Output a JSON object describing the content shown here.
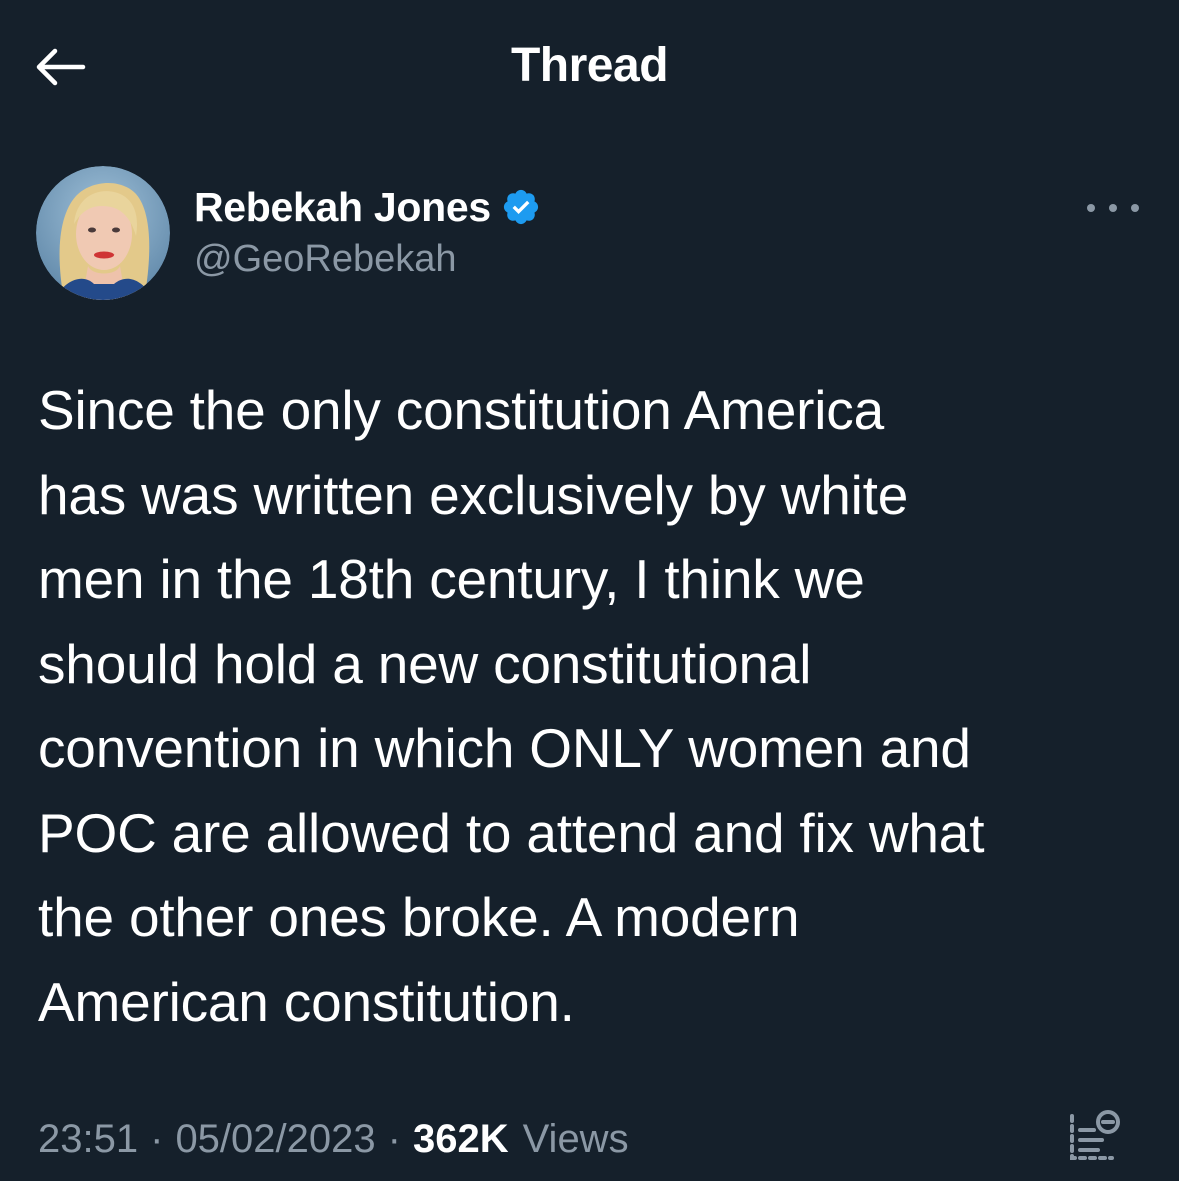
{
  "header": {
    "title": "Thread",
    "back_icon": "arrow-left-icon"
  },
  "author": {
    "display_name": "Rebekah Jones",
    "handle": "@GeoRebekah",
    "verified_icon": "verified-badge-icon",
    "verified_color": "#1d9bf0",
    "more_icon": "more-horizontal-icon"
  },
  "tweet": {
    "text": "Since the only constitution America\nhas was written exclusively by white\nmen in the 18th century, I think we\nshould hold a new constitutional\nconvention in which ONLY women and\nPOC are allowed to attend and fix what\nthe other ones broke. A modern\nAmerican constitution."
  },
  "meta": {
    "time": "23:51",
    "date": "05/02/2023",
    "separator": "·",
    "views_count": "362K",
    "views_label": "Views",
    "analytics_icon": "analytics-icon"
  },
  "colors": {
    "background": "#15202b",
    "text_primary": "#ffffff",
    "text_secondary": "#8b98a5",
    "accent": "#1d9bf0"
  }
}
